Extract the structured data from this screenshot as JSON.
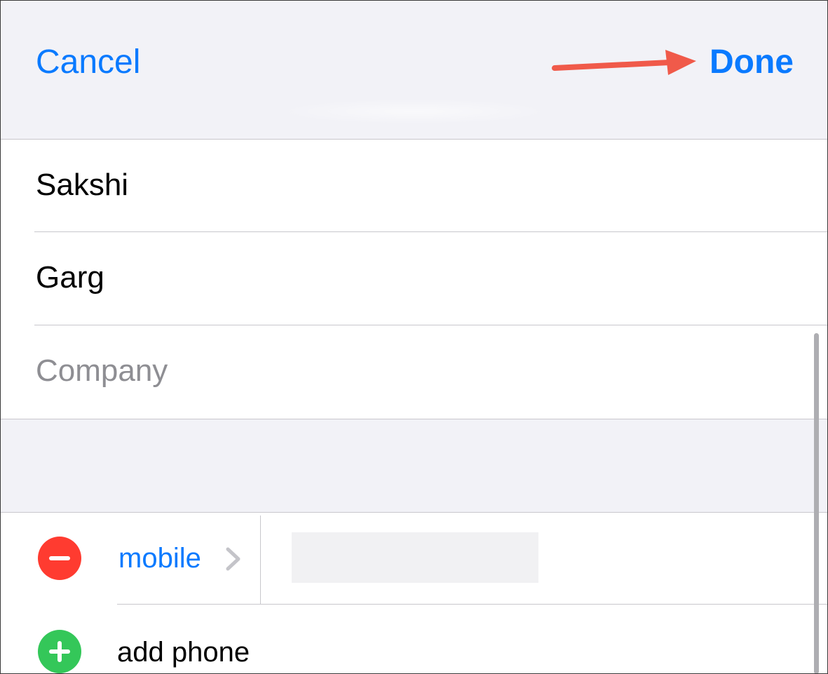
{
  "nav": {
    "cancel_label": "Cancel",
    "done_label": "Done",
    "accent_color": "#0A7AFF",
    "annotation_arrow_color": "#F05A4A"
  },
  "fields": {
    "first_name": "Sakshi",
    "last_name": "Garg",
    "company_placeholder": "Company"
  },
  "phone": {
    "label": "mobile",
    "remove_icon": "minus-circle-icon",
    "chevron_icon": "chevron-right-icon",
    "add_label": "add phone",
    "add_icon": "plus-circle-icon",
    "remove_color": "#FF3B30",
    "add_color": "#34C759"
  }
}
